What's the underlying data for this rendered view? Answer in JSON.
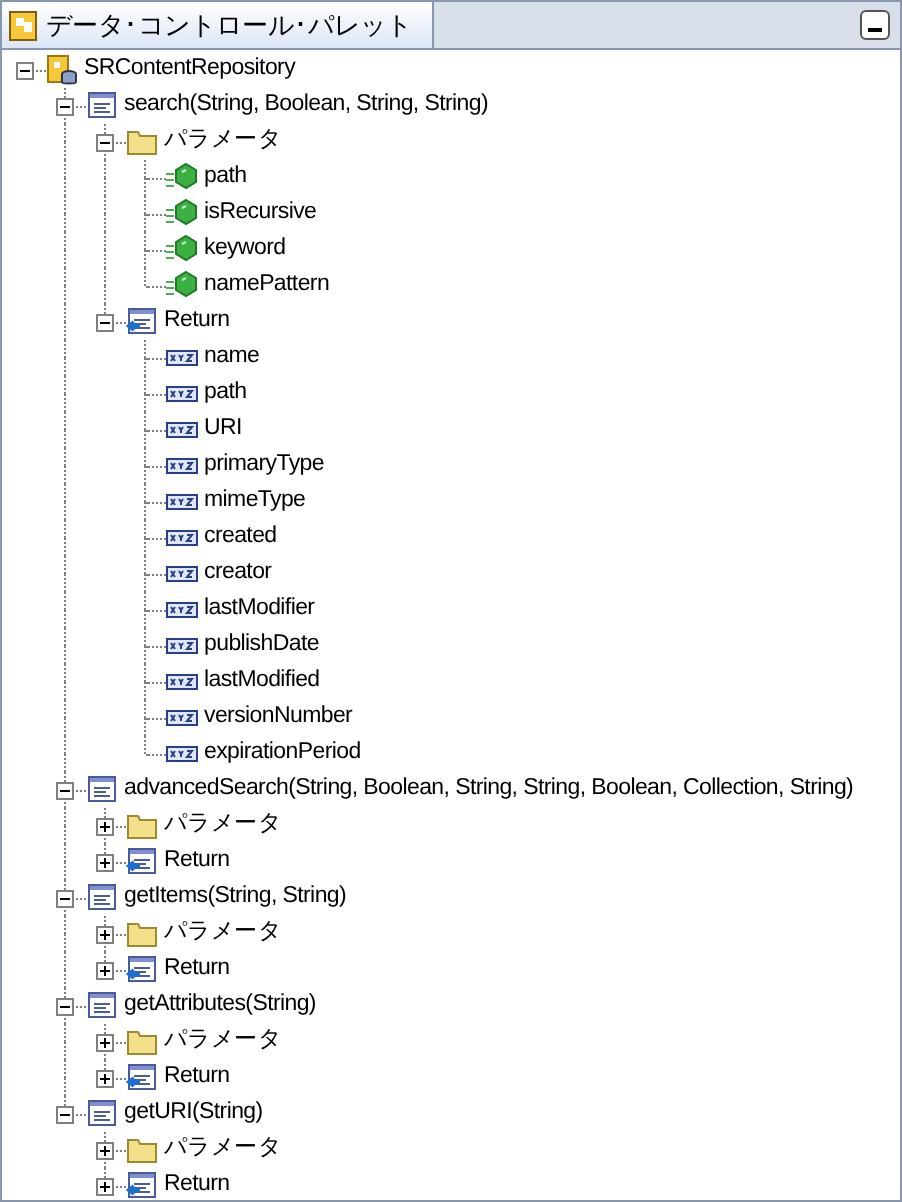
{
  "panel": {
    "title": "データ･コントロール･パレット"
  },
  "tree": [
    {
      "label": "SRContentRepository",
      "kind": "repository",
      "expanded": true,
      "children": [
        {
          "label": "search(String, Boolean, String, String)",
          "kind": "method",
          "expanded": true,
          "children": [
            {
              "label": "パラメータ",
              "kind": "folder",
              "expanded": true,
              "children": [
                {
                  "label": "path",
                  "kind": "param"
                },
                {
                  "label": "isRecursive",
                  "kind": "param"
                },
                {
                  "label": "keyword",
                  "kind": "param"
                },
                {
                  "label": "namePattern",
                  "kind": "param"
                }
              ]
            },
            {
              "label": "Return",
              "kind": "return",
              "expanded": true,
              "children": [
                {
                  "label": "name",
                  "kind": "field"
                },
                {
                  "label": "path",
                  "kind": "field"
                },
                {
                  "label": "URI",
                  "kind": "field"
                },
                {
                  "label": "primaryType",
                  "kind": "field"
                },
                {
                  "label": "mimeType",
                  "kind": "field"
                },
                {
                  "label": "created",
                  "kind": "field"
                },
                {
                  "label": "creator",
                  "kind": "field"
                },
                {
                  "label": "lastModifier",
                  "kind": "field"
                },
                {
                  "label": "publishDate",
                  "kind": "field"
                },
                {
                  "label": "lastModified",
                  "kind": "field"
                },
                {
                  "label": "versionNumber",
                  "kind": "field"
                },
                {
                  "label": "expirationPeriod",
                  "kind": "field"
                }
              ]
            }
          ]
        },
        {
          "label": "advancedSearch(String, Boolean, String, String, Boolean, Collection, String)",
          "kind": "method",
          "expanded": true,
          "children": [
            {
              "label": "パラメータ",
              "kind": "folder",
              "expanded": false
            },
            {
              "label": "Return",
              "kind": "return",
              "expanded": false
            }
          ]
        },
        {
          "label": "getItems(String, String)",
          "kind": "method",
          "expanded": true,
          "children": [
            {
              "label": "パラメータ",
              "kind": "folder",
              "expanded": false
            },
            {
              "label": "Return",
              "kind": "return",
              "expanded": false
            }
          ]
        },
        {
          "label": "getAttributes(String)",
          "kind": "method",
          "expanded": true,
          "children": [
            {
              "label": "パラメータ",
              "kind": "folder",
              "expanded": false
            },
            {
              "label": "Return",
              "kind": "return",
              "expanded": false
            }
          ]
        },
        {
          "label": "getURI(String)",
          "kind": "method",
          "expanded": true,
          "children": [
            {
              "label": "パラメータ",
              "kind": "folder",
              "expanded": false
            },
            {
              "label": "Return",
              "kind": "return",
              "expanded": false
            }
          ]
        }
      ]
    }
  ]
}
